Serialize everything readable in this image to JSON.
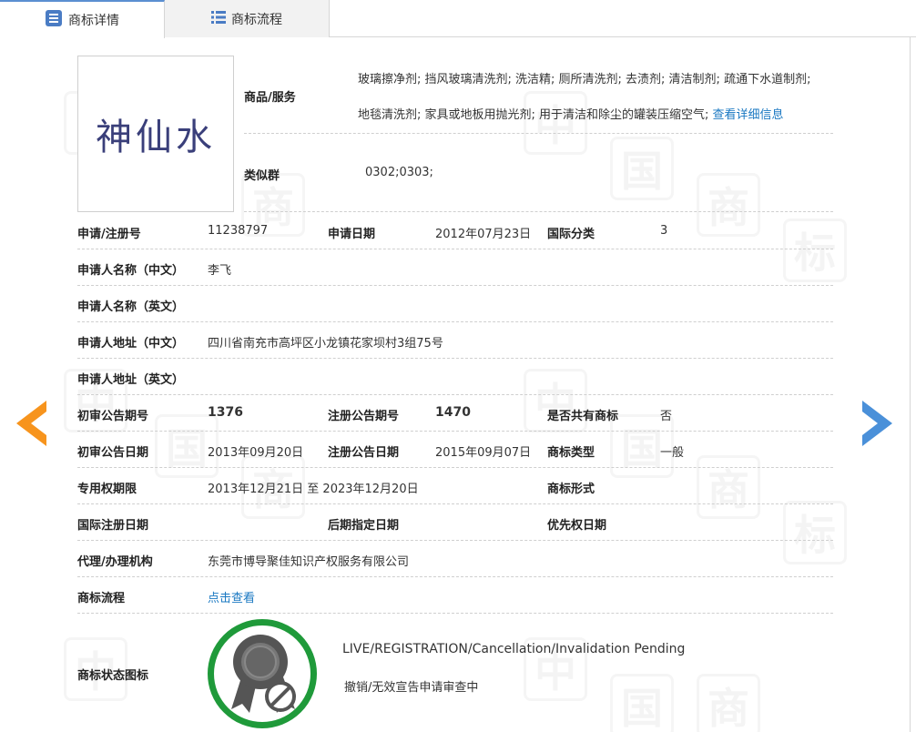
{
  "tabs": [
    {
      "label": "商标详情"
    },
    {
      "label": "商标流程"
    }
  ],
  "trademark": {
    "image_text": "神仙水",
    "goods_label": "商品/服务",
    "goods_line1": "玻璃擦净剂; 挡风玻璃清洗剂; 洗洁精; 厕所清洗剂; 去渍剂; 清洁制剂; 疏通下水道制剂;",
    "goods_line2": "地毯清洗剂; 家具或地板用抛光剂; 用于清洁和除尘的罐装压缩空气;",
    "goods_more_link": "查看详细信息",
    "similar_group_label": "类似群",
    "similar_group_value": "0302;0303;"
  },
  "details": {
    "reg_no_label": "申请/注册号",
    "reg_no": "11238797",
    "app_date_label": "申请日期",
    "app_date": "2012年07月23日",
    "intl_class_label": "国际分类",
    "intl_class": "3",
    "applicant_cn_label": "申请人名称（中文）",
    "applicant_cn": "李飞",
    "applicant_en_label": "申请人名称（英文）",
    "applicant_en": "",
    "address_cn_label": "申请人地址（中文）",
    "address_cn": "四川省南充市高坪区小龙镇花家坝村3组75号",
    "address_en_label": "申请人地址（英文）",
    "address_en": "",
    "prelim_issue_label": "初审公告期号",
    "prelim_issue": "1376",
    "reg_issue_label": "注册公告期号",
    "reg_issue": "1470",
    "shared_label": "是否共有商标",
    "shared": "否",
    "prelim_date_label": "初审公告日期",
    "prelim_date": "2013年09月20日",
    "reg_date_label": "注册公告日期",
    "reg_date": "2015年09月07日",
    "tm_type_label": "商标类型",
    "tm_type": "一般",
    "exclusive_label": "专用权期限",
    "exclusive": "2013年12月21日 至 2023年12月20日",
    "tm_form_label": "商标形式",
    "tm_form": "",
    "intl_reg_date_label": "国际注册日期",
    "later_date_label": "后期指定日期",
    "priority_date_label": "优先权日期",
    "agent_label": "代理/办理机构",
    "agent": "东莞市博导聚佳知识产权服务有限公司",
    "flow_label": "商标流程",
    "flow_link": "点击查看",
    "status_label": "商标状态图标",
    "status_en": "LIVE/REGISTRATION/Cancellation/Invalidation Pending",
    "status_cn": "撤销/无效宣告申请审查中"
  },
  "icons": {
    "tab_detail": "list-doc-icon",
    "tab_flow": "list-icon",
    "prev": "arrow-left-icon",
    "next": "arrow-right-icon",
    "status": "award-ribbon-blocked-icon"
  },
  "colors": {
    "accent": "#1a78c2",
    "arrow_left": "#f7941d",
    "arrow_right": "#4a90d9",
    "status_ring": "#1f9a3a"
  }
}
